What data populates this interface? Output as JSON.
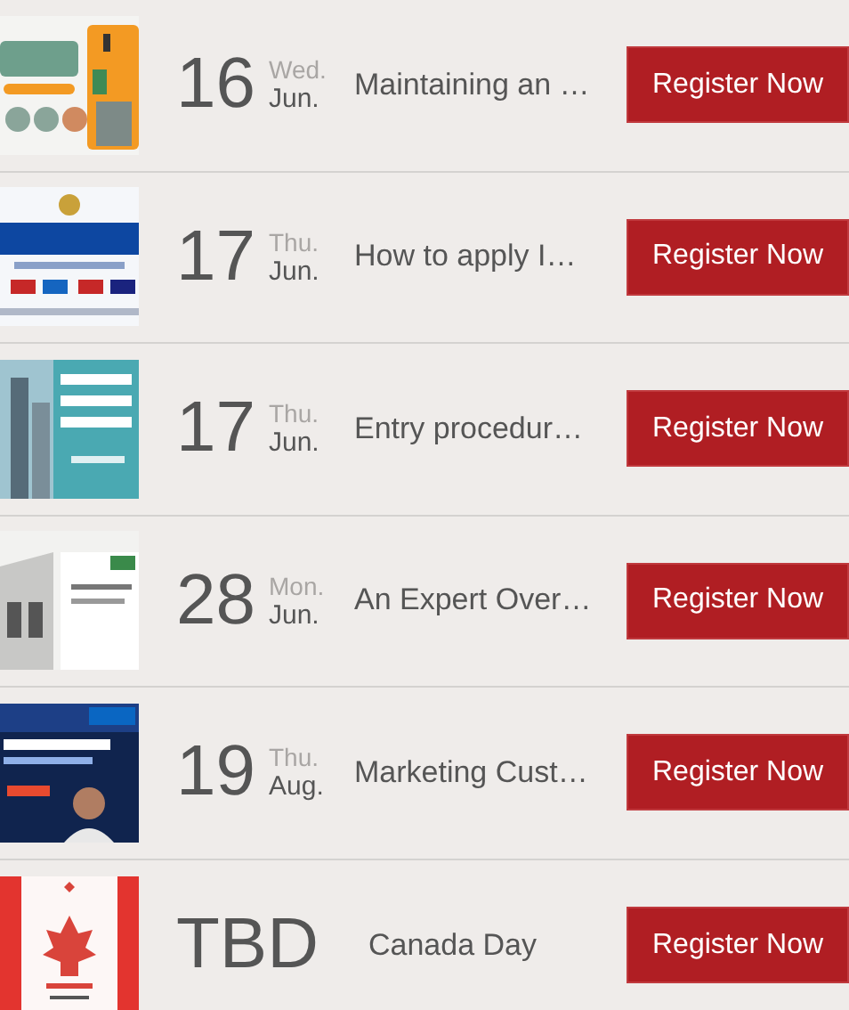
{
  "events": [
    {
      "day": "16",
      "weekday": "Wed.",
      "month": "Jun.",
      "title": "Maintaining an …",
      "button": "Register Now"
    },
    {
      "day": "17",
      "weekday": "Thu.",
      "month": "Jun.",
      "title": "How to apply I…",
      "button": "Register Now"
    },
    {
      "day": "17",
      "weekday": "Thu.",
      "month": "Jun.",
      "title": "Entry procedur…",
      "button": "Register Now"
    },
    {
      "day": "28",
      "weekday": "Mon.",
      "month": "Jun.",
      "title": "An Expert Over…",
      "button": "Register Now"
    },
    {
      "day": "19",
      "weekday": "Thu.",
      "month": "Aug.",
      "title": "Marketing Cust…",
      "button": "Register Now"
    },
    {
      "day": "TBD",
      "title": "Canada Day",
      "button": "Register Now"
    }
  ]
}
